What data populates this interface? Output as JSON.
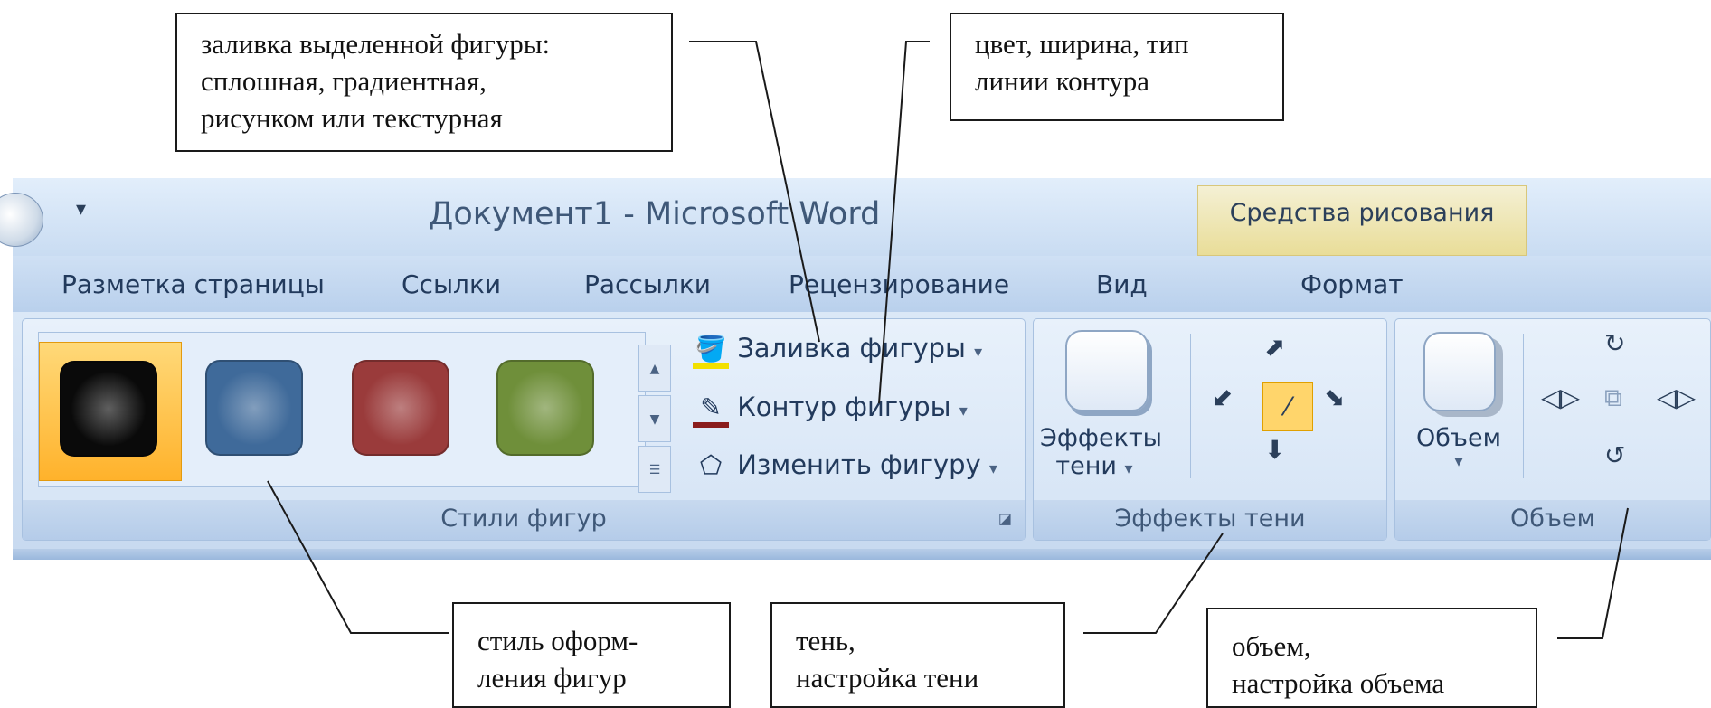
{
  "window": {
    "title": "Документ1 - Microsoft Word",
    "context_group": "Средства рисования"
  },
  "tabs": [
    {
      "label": "Разметка страницы"
    },
    {
      "label": "Ссылки"
    },
    {
      "label": "Рассылки"
    },
    {
      "label": "Рецензирование"
    },
    {
      "label": "Вид"
    },
    {
      "label": "Формат",
      "active": true
    }
  ],
  "groups": {
    "shape_styles": {
      "label": "Стили фигур",
      "commands": {
        "fill": "Заливка фигуры",
        "outline": "Контур фигуры",
        "change": "Изменить фигуру"
      },
      "swatch_colors": [
        "#0a0a0a",
        "#3f6a9a",
        "#9a3b3b",
        "#6f8f3a"
      ],
      "selected_swatch": 0
    },
    "shadow_effects": {
      "label": "Эффекты тени",
      "button_line1": "Эффекты",
      "button_line2": "тени"
    },
    "volume": {
      "label": "Объем",
      "button": "Объем"
    }
  },
  "callouts": {
    "fill": [
      "заливка выделенной фигуры:",
      "сплошная, градиентная,",
      "рисунком или текстурная"
    ],
    "outline": [
      "цвет, ширина, тип",
      "линии контура"
    ],
    "style": [
      "стиль оформ-",
      "ления фигур"
    ],
    "shadow": [
      "тень,",
      "настройка тени"
    ],
    "volume": [
      "объем,",
      "настройка объема"
    ]
  },
  "colors": {
    "accent_active_tab": "#ffe39a",
    "ribbon": "#d4e3f5",
    "title_text": "#3f5878"
  }
}
